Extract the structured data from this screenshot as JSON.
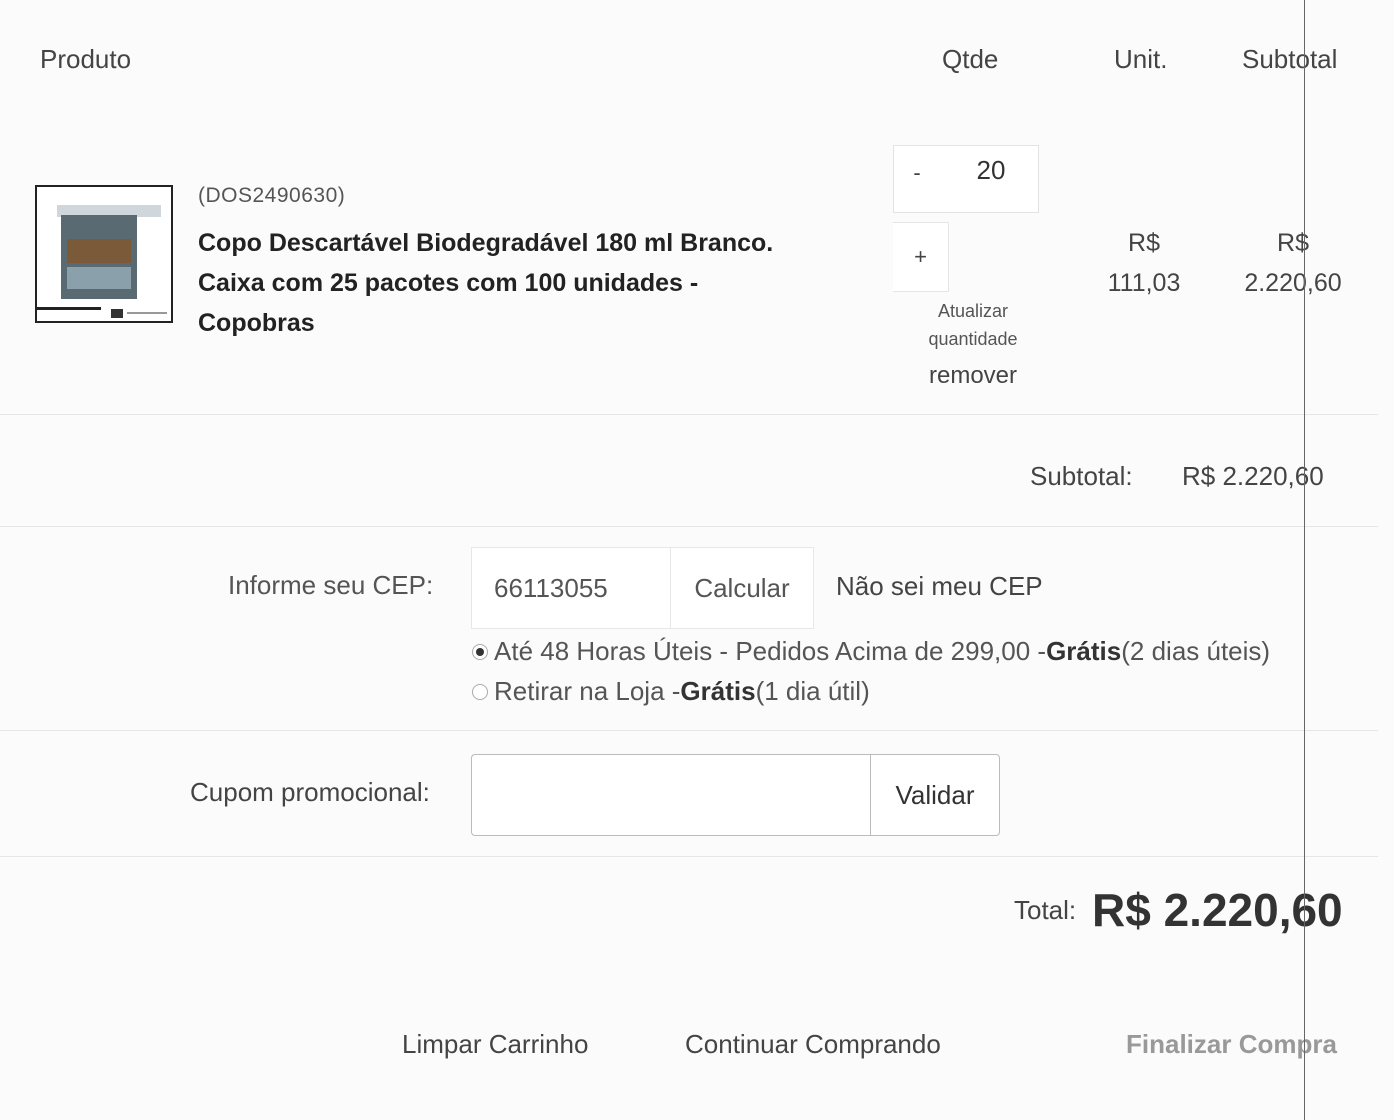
{
  "header": {
    "product": "Produto",
    "qty": "Qtde",
    "unit": "Unit.",
    "subtotal": "Subtotal"
  },
  "item": {
    "sku": "(DOS2490630)",
    "name_line1": "Copo Descartável Biodegradável 180 ml Branco.",
    "name_line2": "Caixa com 25 pacotes com 100 unidades -",
    "name_line3": "Copobras",
    "minus_label": "-",
    "quantity": "20",
    "plus_label": "+",
    "update_line1": "Atualizar",
    "update_line2": "quantidade",
    "remove_label": "remover",
    "unit_currency": "R$",
    "unit_value": "111,03",
    "subtotal_currency": "R$",
    "subtotal_value": "2.220,60"
  },
  "summary": {
    "subtotal_label": "Subtotal:",
    "subtotal_value": "R$ 2.220,60"
  },
  "shipping": {
    "cep_label": "Informe seu CEP:",
    "cep_value": "66113055",
    "calc_label": "Calcular",
    "unknown_cep_link": "Não sei meu CEP",
    "options": [
      {
        "text": "Até 48 Horas Úteis - Pedidos Acima de 299,00 - ",
        "bold": "Grátis",
        "extra": " (2 dias úteis)",
        "selected": true
      },
      {
        "text": "Retirar na Loja - ",
        "bold": "Grátis",
        "extra": " (1 dia útil)",
        "selected": false
      }
    ]
  },
  "coupon": {
    "label": "Cupom promocional:",
    "value": "",
    "validate_label": "Validar"
  },
  "total": {
    "label": "Total:",
    "value": "R$ 2.220,60"
  },
  "actions": {
    "clear_cart": "Limpar Carrinho",
    "continue_shopping": "Continuar Comprando",
    "checkout": "Finalizar Compra"
  },
  "icons": {
    "product_image": "product-thumbnail"
  }
}
